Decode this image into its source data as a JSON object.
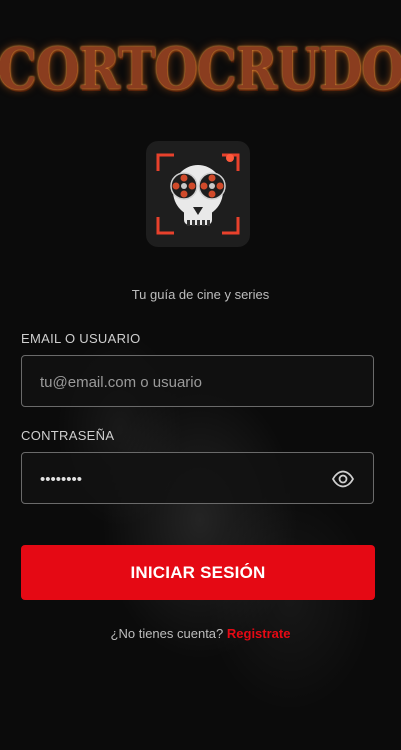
{
  "brand": {
    "logo_text": "CORTOCRUDO",
    "app_icon": "skull-film-reel-icon"
  },
  "tagline": "Tu guía de cine y series",
  "form": {
    "email_label": "EMAIL O USUARIO",
    "email_placeholder": "tu@email.com o usuario",
    "email_value": "",
    "password_label": "CONTRASEÑA",
    "password_value": "••••••••",
    "password_icon": "eye-icon",
    "submit_label": "INICIAR SESIÓN"
  },
  "signup": {
    "prompt": "¿No tienes cuenta?",
    "link": "Registrate"
  },
  "colors": {
    "accent": "#e50914",
    "background": "#0b0b0b"
  }
}
